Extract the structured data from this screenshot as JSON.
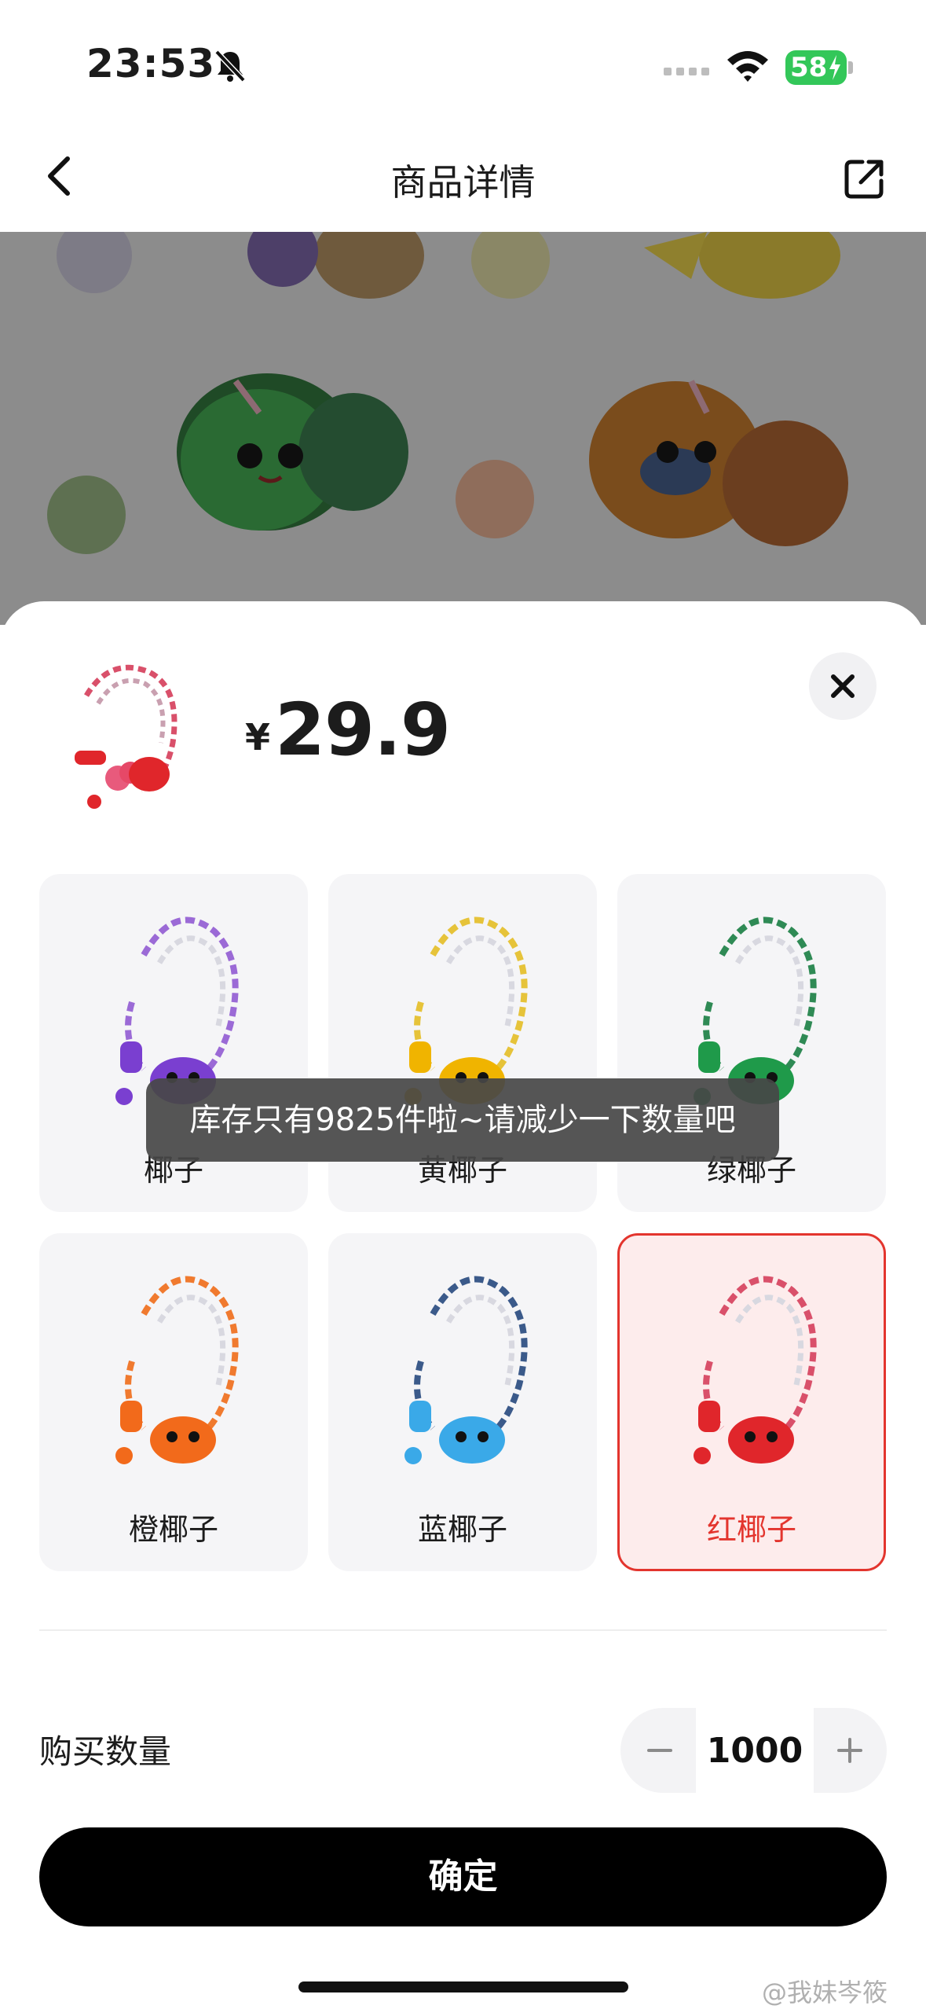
{
  "status_bar": {
    "time": "23:53",
    "battery": "58"
  },
  "nav": {
    "title": "商品详情"
  },
  "product": {
    "currency": "¥",
    "price": "29.9"
  },
  "variants": [
    {
      "label": "椰子",
      "color": "#9b6ad6",
      "accent": "#7a3fd0",
      "selected": false
    },
    {
      "label": "黄椰子",
      "color": "#e6c33a",
      "accent": "#f0b400",
      "selected": false
    },
    {
      "label": "绿椰子",
      "color": "#2f8a55",
      "accent": "#1f9a4a",
      "selected": false
    },
    {
      "label": "橙椰子",
      "color": "#f07a2f",
      "accent": "#f26a1b",
      "selected": false
    },
    {
      "label": "蓝椰子",
      "color": "#3b5a8a",
      "accent": "#3aa9e8",
      "selected": false
    },
    {
      "label": "红椰子",
      "color": "#d9506a",
      "accent": "#e0262b",
      "selected": true
    }
  ],
  "quantity": {
    "label": "购买数量",
    "value": "1000"
  },
  "confirm": {
    "label": "确定"
  },
  "toast": {
    "message": "库存只有9825件啦~请减少一下数量吧"
  },
  "watermark": {
    "text": "@我妹岑筱"
  },
  "colors": {
    "accent_red": "#e3352e",
    "button_black": "#000000",
    "battery_green": "#33c759"
  }
}
